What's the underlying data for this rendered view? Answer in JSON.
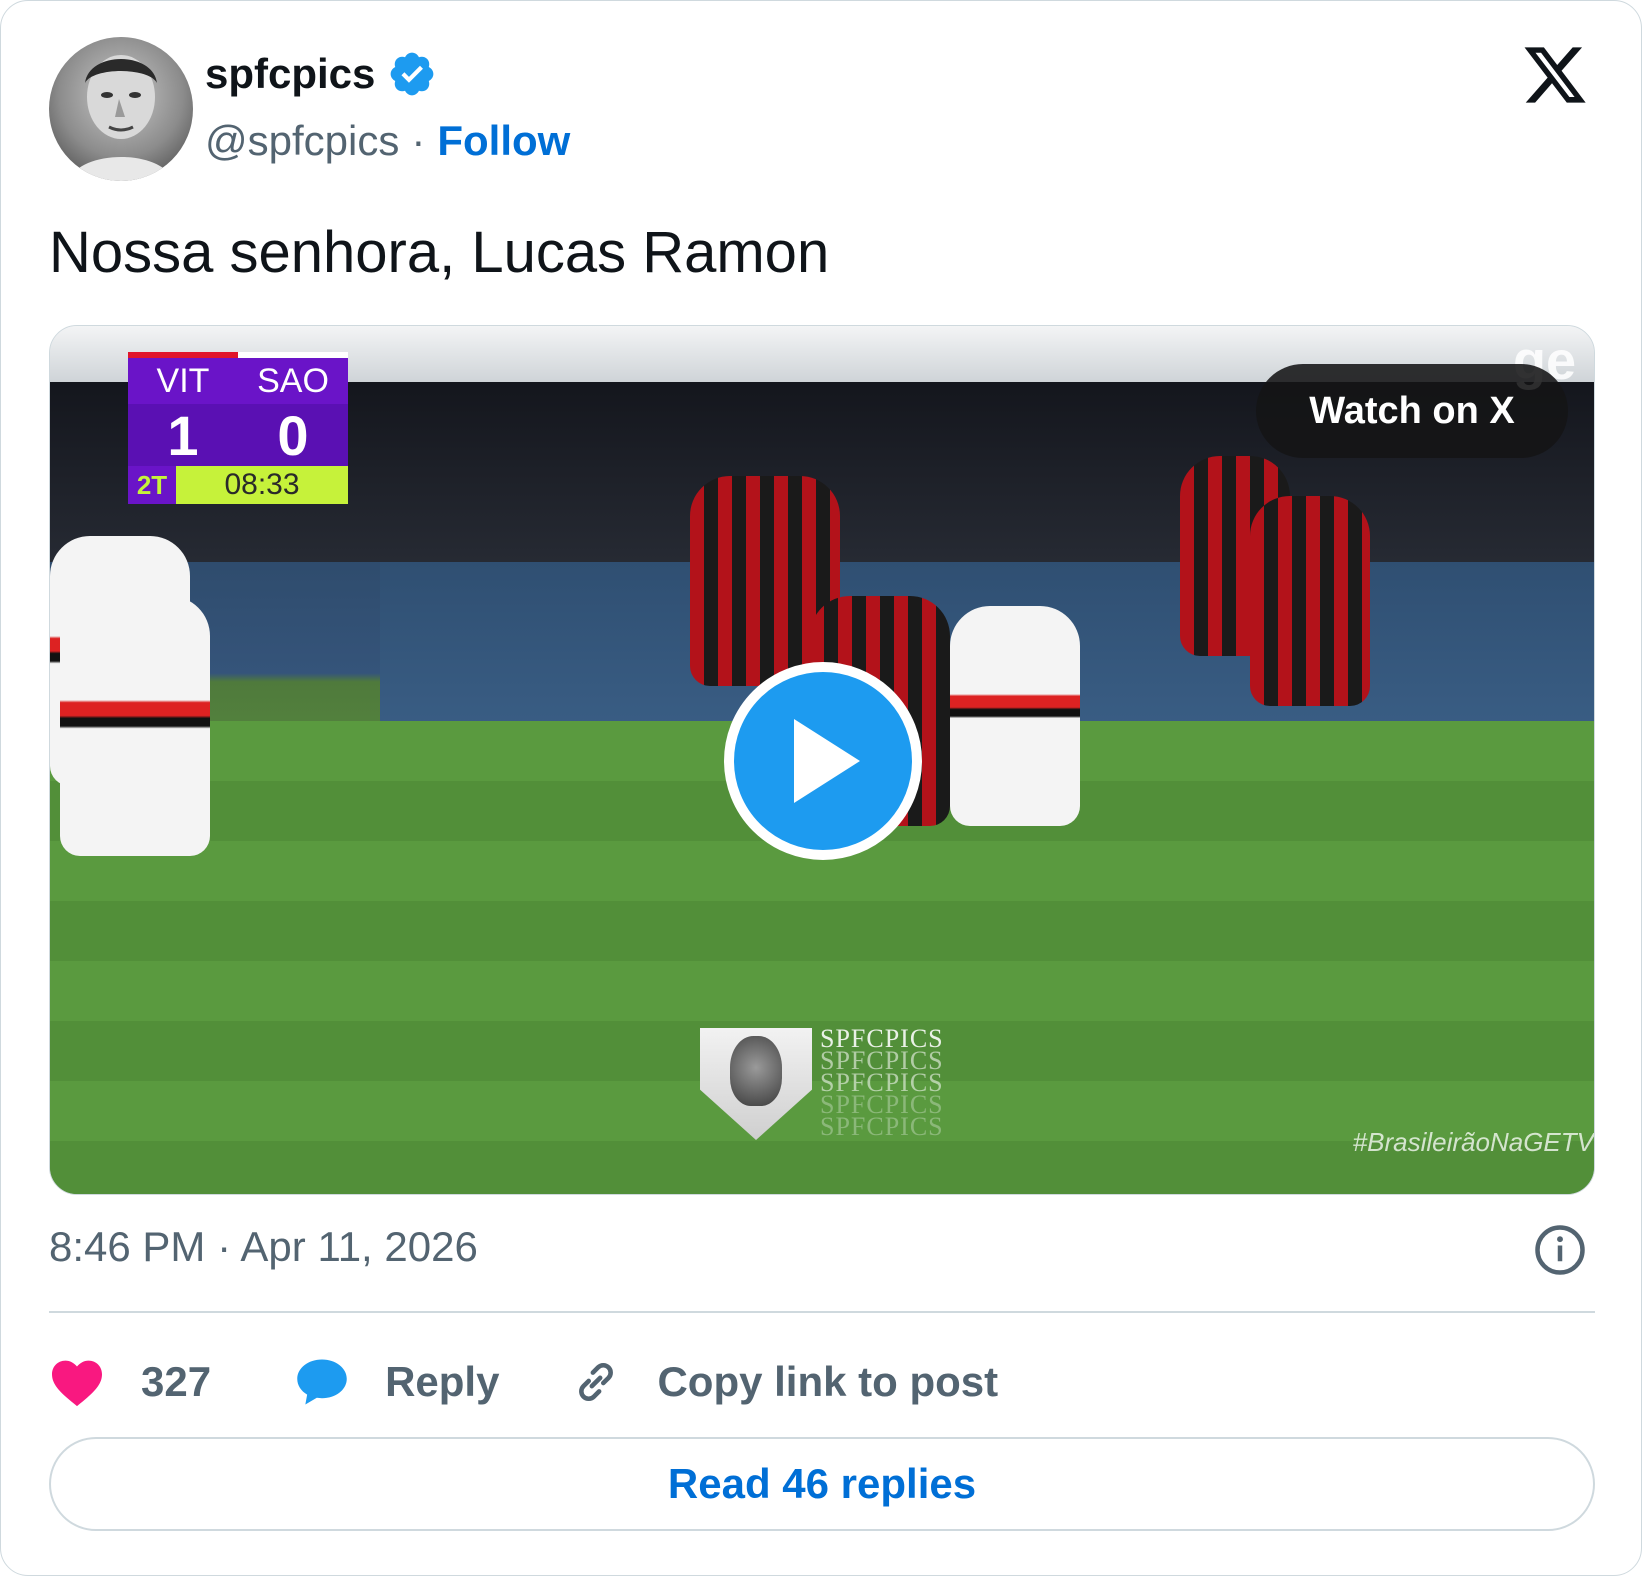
{
  "author": {
    "name": "spfcpics",
    "handle": "@spfcpics",
    "separator": "·",
    "follow_label": "Follow",
    "verified_icon": "verified-badge-icon"
  },
  "tweet": {
    "text": "Nossa senhora, Lucas Ramon",
    "timestamp": "8:46 PM · Apr 11, 2026"
  },
  "media": {
    "watch_label": "Watch on X",
    "scoreboard": {
      "home_team": "VIT",
      "away_team": "SAO",
      "home_score": "1",
      "away_score": "0",
      "period": "2T",
      "clock": "08:33"
    },
    "watermark_lines": [
      "SPFCPICS",
      "SPFCPICS",
      "SPFCPICS",
      "SPFCPICS",
      "SPFCPICS"
    ],
    "hashtag": "#BrasileirãoNaGETV",
    "broadcaster_logo": "ge"
  },
  "actions": {
    "like_count": "327",
    "reply_label": "Reply",
    "copy_label": "Copy link to post"
  },
  "read_replies_label": "Read 46 replies",
  "colors": {
    "link_blue": "#006fd6",
    "play_blue": "#1d9bf0",
    "like_pink": "#f91880",
    "reply_blue": "#1d9bf0",
    "text_gray": "#536471"
  }
}
